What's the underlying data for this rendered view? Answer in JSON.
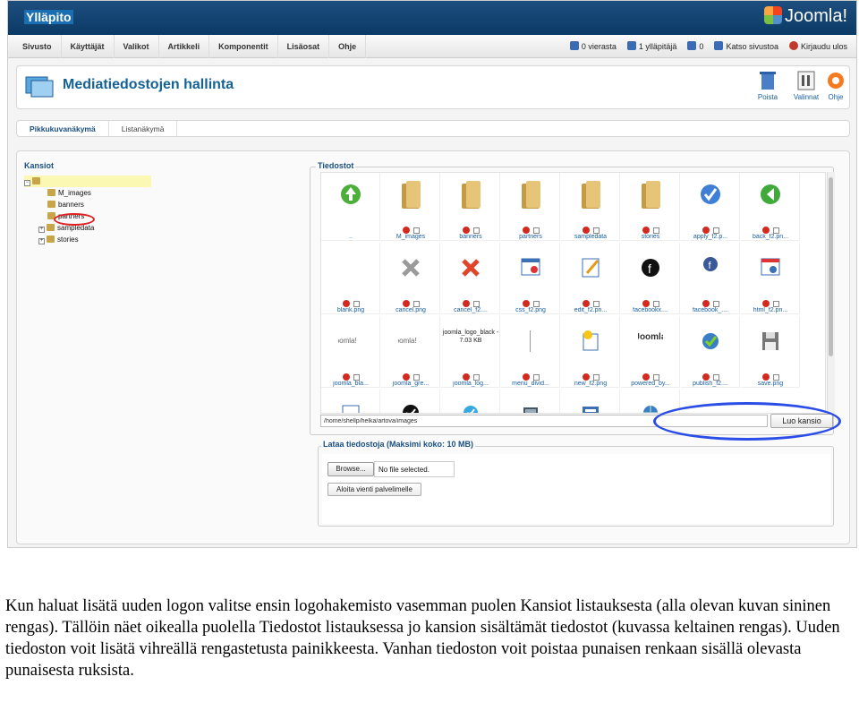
{
  "header": {
    "brand": "Ylläpito",
    "logo_text": "Joomla!"
  },
  "menu": [
    "Sivusto",
    "Käyttäjät",
    "Valikot",
    "Artikkeli",
    "Komponentit",
    "Lisäosat",
    "Ohje"
  ],
  "status": [
    {
      "text": "0 vierasta",
      "icon": "visitors-icon",
      "color": "#3a6bb3"
    },
    {
      "text": "1 ylläpitäjä",
      "icon": "admins-icon",
      "color": "#3a6bb3"
    },
    {
      "text": "0",
      "icon": "messages-icon",
      "color": "#3a6bb3"
    },
    {
      "text": "Katso sivustoa",
      "icon": "view-site-icon",
      "color": "#3a6bb3"
    },
    {
      "text": "Kirjaudu ulos",
      "icon": "logout-icon",
      "color": "#c0392b"
    }
  ],
  "page": {
    "title": "Mediatiedostojen hallinta"
  },
  "toolbar": {
    "delete": "Poista",
    "settings": "Valinnat",
    "help": "Ohje"
  },
  "tabs": [
    "Pikkukuvanäkymä",
    "Listanäkymä"
  ],
  "folders": {
    "legend": "Kansiot",
    "children": [
      "M_images",
      "banners",
      "partners",
      "sampledata",
      "stories"
    ]
  },
  "files": {
    "legend": "Tiedostot",
    "rows": [
      [
        {
          "name": "..",
          "type": "up"
        },
        {
          "name": "M_images",
          "type": "folder"
        },
        {
          "name": "banners",
          "type": "folder"
        },
        {
          "name": "partners",
          "type": "folder"
        },
        {
          "name": "sampledata",
          "type": "folder"
        },
        {
          "name": "stories",
          "type": "folder"
        },
        {
          "name": "apply_f2.p...",
          "type": "apply"
        },
        {
          "name": "back_f2.pn...",
          "type": "back"
        }
      ],
      [
        {
          "name": "blank.png",
          "type": "blank"
        },
        {
          "name": "cancel.png",
          "type": "cancel-grey"
        },
        {
          "name": "cancel_f2....",
          "type": "cancel-red"
        },
        {
          "name": "css_f2.png",
          "type": "css"
        },
        {
          "name": "edit_f2.pn...",
          "type": "edit"
        },
        {
          "name": "facebookx....",
          "type": "facebook"
        },
        {
          "name": "facebook_....",
          "type": "facebook-small"
        },
        {
          "name": "html_f2.pn...",
          "type": "html"
        }
      ],
      [
        {
          "name": "joomla_bla...",
          "type": "joomla-logo"
        },
        {
          "name": "joomla_gre...",
          "type": "joomla-logo"
        },
        {
          "name": "joomla_log...",
          "type": "joomla-text",
          "caption": "joomla_logo_black - 7.03 KB"
        },
        {
          "name": "menu_divid...",
          "type": "divider"
        },
        {
          "name": "new_f2.png",
          "type": "new"
        },
        {
          "name": "powered_by...",
          "type": "joomla-color"
        },
        {
          "name": "publish_f2....",
          "type": "publish"
        },
        {
          "name": "save.png",
          "type": "save"
        }
      ],
      [
        {
          "name": "",
          "type": "note"
        },
        {
          "name": "",
          "type": "twitter-black"
        },
        {
          "name": "",
          "type": "twitter-blue"
        },
        {
          "name": "",
          "type": "box"
        },
        {
          "name": "",
          "type": "doc"
        },
        {
          "name": "",
          "type": "globe"
        }
      ]
    ],
    "path": "/home/shellp/helka/artova/images",
    "create_folder": "Luo kansio"
  },
  "upload": {
    "legend": "Lataa tiedostoja (Maksimi koko: 10 MB)",
    "browse": "Browse...",
    "file_name": "No file selected.",
    "start": "Aloita vienti palvelimelle"
  },
  "caption": "Kun haluat lisätä uuden logon valitse ensin logohakemisto vasemman puolen Kansiot listauksesta (alla olevan kuvan sininen rengas). Tällöin näet oikealla puolella Tiedostot listauksessa jo kansion sisältämät tiedostot (kuvassa keltainen rengas). Uuden tiedoston voit lisätä vihreällä rengastetusta painikkeesta. Vanhan tiedoston voit poistaa punaisen renkaan sisällä olevasta punaisesta ruksista."
}
